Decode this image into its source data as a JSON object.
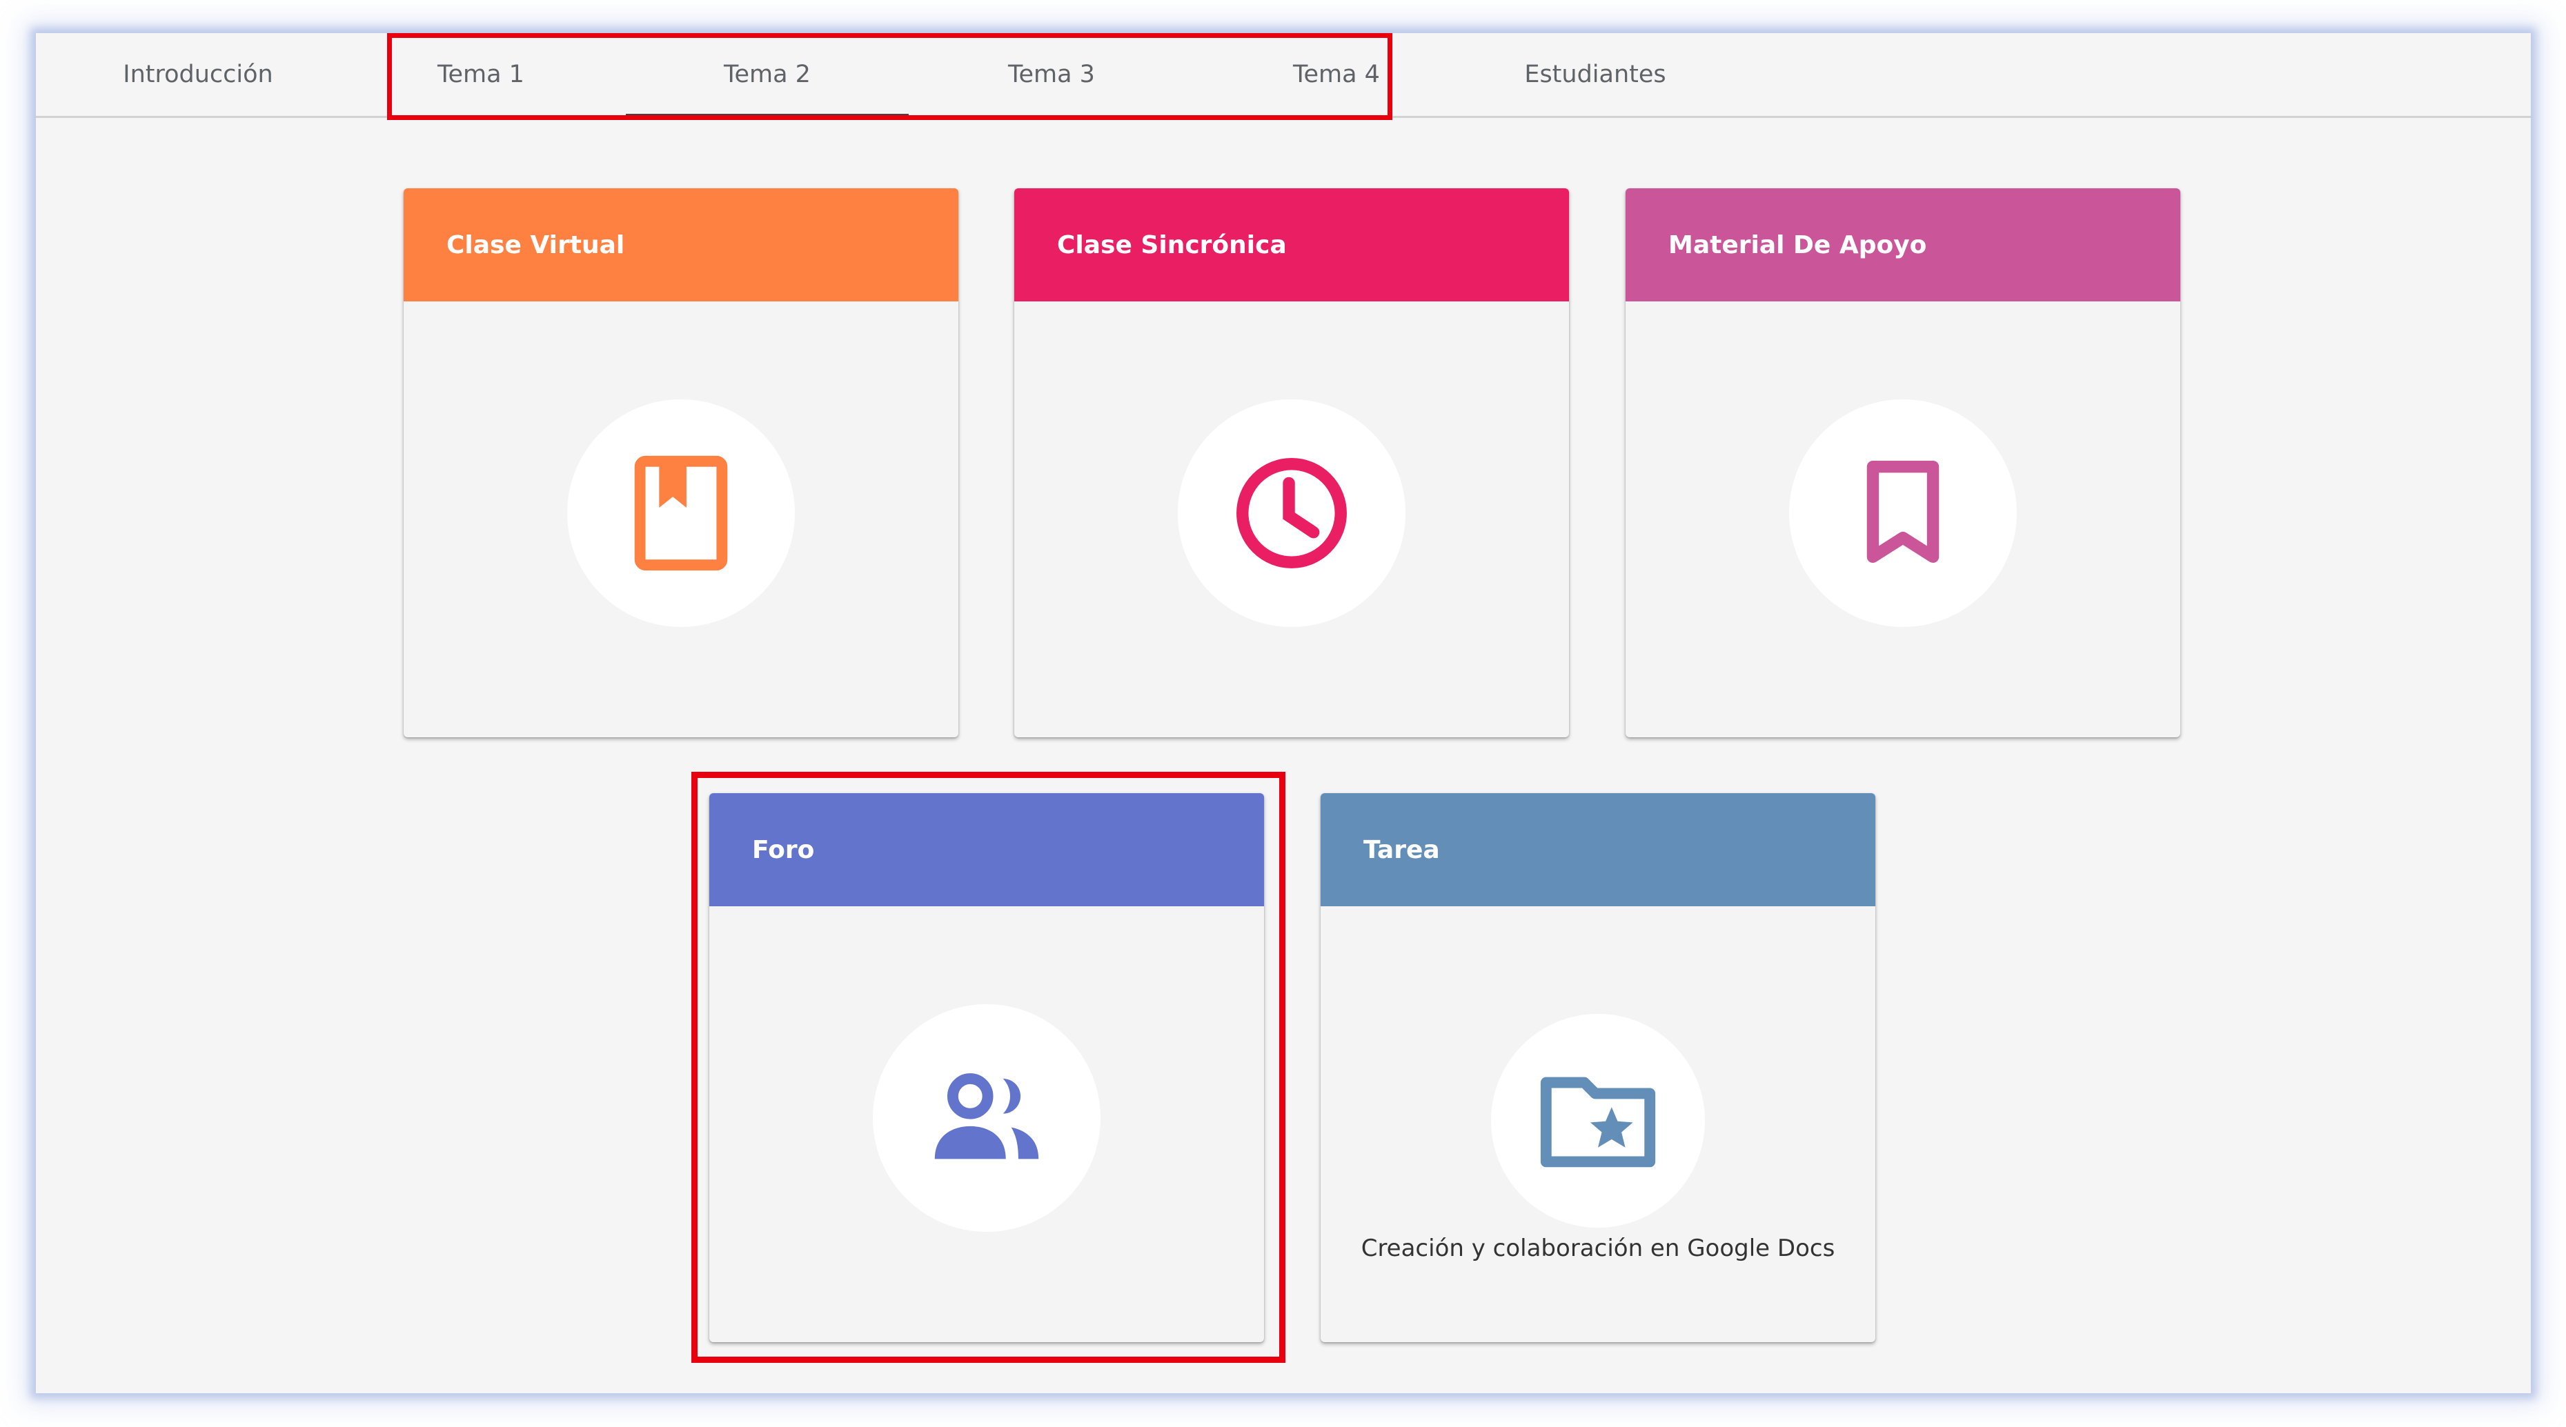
{
  "tabs": [
    {
      "label": "Introducción"
    },
    {
      "label": "Tema 1"
    },
    {
      "label": "Tema 2"
    },
    {
      "label": "Tema 3"
    },
    {
      "label": "Tema 4"
    },
    {
      "label": "Estudiantes"
    }
  ],
  "active_tab": "Tema 2",
  "cards": [
    {
      "title": "Clase Virtual",
      "icon": "book-bookmark-icon",
      "color": "#fe8142"
    },
    {
      "title": "Clase Sincrónica",
      "icon": "clock-icon",
      "color": "#e91e63"
    },
    {
      "title": "Material De Apoyo",
      "icon": "bookmark-icon",
      "color": "#ca5599"
    },
    {
      "title": "Foro",
      "icon": "people-icon",
      "color": "#6274cb"
    },
    {
      "title": "Tarea",
      "icon": "folder-star-icon",
      "color": "#628eb8",
      "description": "Creación y colaboración en Google Docs"
    }
  ],
  "highlight_color": "#e8000f"
}
